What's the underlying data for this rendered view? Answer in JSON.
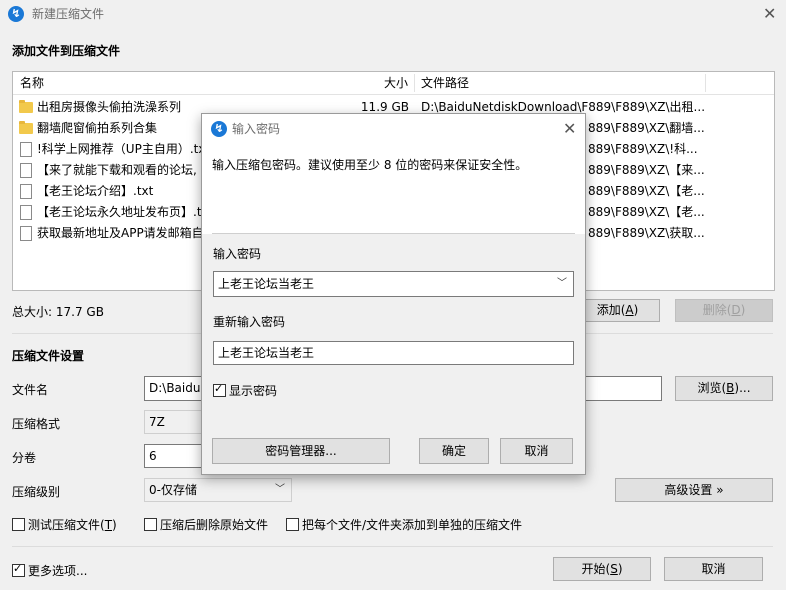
{
  "window": {
    "title": "新建压缩文件",
    "close_glyph": "✕",
    "icon_glyph": "↯"
  },
  "files_section": {
    "title": "添加文件到压缩文件"
  },
  "file_list": {
    "columns": [
      "名称",
      "大小",
      "文件路径"
    ],
    "rows": [
      {
        "icon": "folder-icon",
        "name": "出租房摄像头偷拍洗澡系列",
        "size": "11.9 GB",
        "path": "D:\\BaiduNetdiskDownload\\F889\\F889\\XZ\\出租..."
      },
      {
        "icon": "folder-icon",
        "name": "翻墙爬窗偷拍系列合集",
        "size": "",
        "path": "889\\F889\\XZ\\翻墙..."
      },
      {
        "icon": "file-icon",
        "name": "!科学上网推荐（UP主自用）.txt",
        "size": "",
        "path": "889\\F889\\XZ\\!科..."
      },
      {
        "icon": "file-icon",
        "name": "【来了就能下载和观看的论坛,",
        "size": "",
        "path": "889\\F889\\XZ\\【来..."
      },
      {
        "icon": "file-icon",
        "name": "【老王论坛介绍】.txt",
        "size": "",
        "path": "889\\F889\\XZ\\【老..."
      },
      {
        "icon": "file-icon",
        "name": "【老王论坛永久地址发布页】.tx",
        "size": "",
        "path": "889\\F889\\XZ\\【老..."
      },
      {
        "icon": "file-icon",
        "name": "获取最新地址及APP请发邮箱自",
        "size": "",
        "path": "889\\F889\\XZ\\获取..."
      }
    ]
  },
  "total_size": "总大小: 17.7 GB",
  "buttons": {
    "add": "添加(A)",
    "add_key": "A",
    "remove": "删除(D)",
    "remove_key": "D",
    "browse": "浏览(B)...",
    "browse_key": "B",
    "advanced": "高级设置 »",
    "start": "开始(S)",
    "start_key": "S",
    "cancel": "取消"
  },
  "settings": {
    "title": "压缩文件设置",
    "filename_label": "文件名",
    "filename_value": "D:\\BaiduN",
    "format_label": "压缩格式",
    "format_value": "7Z",
    "volume_label": "分卷",
    "volume_value": "6",
    "level_label": "压缩级别",
    "level_value": "0-仅存储"
  },
  "checkboxes": {
    "test": "测试压缩文件(T)",
    "test_checked": false,
    "delete_after": "压缩后删除原始文件",
    "delete_after_checked": false,
    "separate": "把每个文件/文件夹添加到单独的压缩文件",
    "separate_checked": false,
    "more_options": "更多选项...",
    "more_options_checked": true
  },
  "dialog": {
    "title": "输入密码",
    "close_glyph": "✕",
    "description": "输入压缩包密码。建议使用至少 8 位的密码来保证安全性。",
    "password_label": "输入密码",
    "password_value": "上老王论坛当老王",
    "confirm_label": "重新输入密码",
    "confirm_value": "上老王论坛当老王",
    "show_password": "显示密码",
    "show_password_checked": true,
    "manager_button": "密码管理器...",
    "ok_button": "确定",
    "cancel_button": "取消"
  }
}
